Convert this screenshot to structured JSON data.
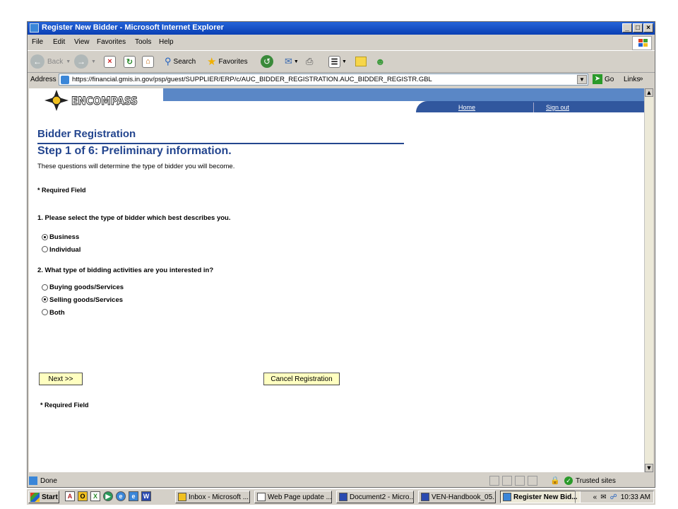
{
  "window": {
    "title": "Register New Bidder - Microsoft Internet Explorer",
    "controls": {
      "minimize": "_",
      "maximize": "□",
      "close": "×"
    }
  },
  "menu": [
    "File",
    "Edit",
    "View",
    "Favorites",
    "Tools",
    "Help"
  ],
  "toolbar": {
    "back": "Back",
    "search": "Search",
    "favorites": "Favorites"
  },
  "address": {
    "label": "Address",
    "url": "https://financial.gmis.in.gov/psp/guest/SUPPLIER/ERP/c/AUC_BIDDER_REGISTRATION.AUC_BIDDER_REGISTR.GBL",
    "go": "Go",
    "links": "Links"
  },
  "header": {
    "logo_text": "ENCOMPASS",
    "home": "Home",
    "signout": "Sign out"
  },
  "page": {
    "title": "Bidder Registration",
    "step": "Step 1 of 6: Preliminary information.",
    "intro": "These questions will determine the type of bidder you will become.",
    "required_top": "* Required Field",
    "q1": "1. Please select the type of bidder which best describes you.",
    "q1_options": [
      {
        "label": "Business",
        "selected": true
      },
      {
        "label": "Individual",
        "selected": false
      }
    ],
    "q2": "2. What type of bidding activities are you interested in?",
    "q2_options": [
      {
        "label": "Buying goods/Services",
        "selected": false
      },
      {
        "label": "Selling goods/Services",
        "selected": true
      },
      {
        "label": "Both",
        "selected": false
      }
    ],
    "next_button": "Next >>",
    "cancel_button": "Cancel Registration",
    "required_bottom": "* Required Field"
  },
  "status": {
    "text": "Done",
    "zone": "Trusted sites"
  },
  "taskbar": {
    "start": "Start",
    "tasks": [
      "Inbox - Microsoft ...",
      "Web Page update ...",
      "Document2 - Micro...",
      "VEN-Handbook_05...",
      "Register New Bid..."
    ],
    "clock": "10:33 AM"
  },
  "colors": {
    "heading": "#24468f",
    "button": "#ffffc0",
    "nav": "#31579e"
  }
}
